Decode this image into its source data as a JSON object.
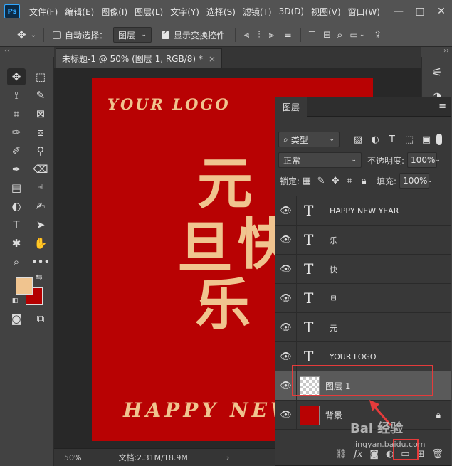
{
  "app": {
    "logo": "Ps",
    "menu": [
      "文件(F)",
      "编辑(E)",
      "图像(I)",
      "图层(L)",
      "文字(Y)",
      "选择(S)",
      "滤镜(T)",
      "3D(D)",
      "视图(V)",
      "窗口(W)"
    ],
    "window_controls": {
      "minimize": "—",
      "restore": "□",
      "close": "✕"
    }
  },
  "options_bar": {
    "auto_select_label": "自动选择：",
    "auto_select_target": "图层",
    "show_transform_label": "显示变换控件"
  },
  "panel_collapse": "‹‹",
  "right_collapse": "››",
  "document": {
    "tab_title": "未标题-1 @ 50% (图层 1, RGB/8) *",
    "tab_close": "×"
  },
  "canvas": {
    "logo_text": "YOUR LOGO",
    "char_yuan": "元",
    "char_dan": "旦",
    "char_kuai": "快",
    "char_le": "乐",
    "bottom_text": "HAPPY NEW"
  },
  "colors": {
    "canvas_red": "#b80203",
    "text_gold": "#f0c48f",
    "foreground": "#f0c48f",
    "background": "#b40000",
    "annotation": "#e53b3b"
  },
  "status": {
    "zoom": "50%",
    "doc_info": "文档:2.31M/18.9M",
    "arrow": "›"
  },
  "layers_panel": {
    "tab": "图层",
    "filter_kind": "类型",
    "blend_mode": "正常",
    "opacity_label": "不透明度:",
    "opacity_value": "100%",
    "lock_label": "锁定:",
    "fill_label": "填充:",
    "fill_value": "100%",
    "layers": [
      {
        "name": "HAPPY NEW YEAR",
        "kind": "text",
        "thumb_glyph": "T"
      },
      {
        "name": "乐",
        "kind": "text",
        "thumb_glyph": "T"
      },
      {
        "name": "快",
        "kind": "text",
        "thumb_glyph": "T"
      },
      {
        "name": "旦",
        "kind": "text",
        "thumb_glyph": "T"
      },
      {
        "name": "元",
        "kind": "text",
        "thumb_glyph": "T"
      },
      {
        "name": "YOUR LOGO",
        "kind": "text",
        "thumb_glyph": "T"
      },
      {
        "name": "图层 1",
        "kind": "pixel",
        "selected": true
      },
      {
        "name": "背景",
        "kind": "background",
        "locked": true
      }
    ]
  },
  "watermark": {
    "brand": "Bai 经验",
    "url": "jingyan.baidu.com"
  }
}
